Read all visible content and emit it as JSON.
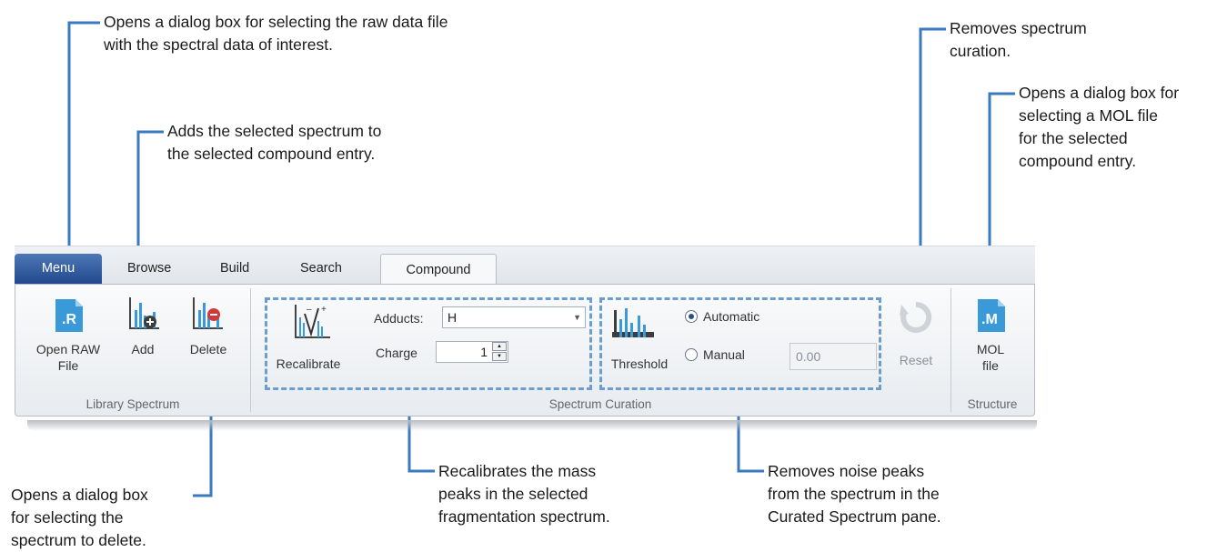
{
  "callouts": {
    "open_raw": [
      "Opens a dialog box for selecting the raw data file",
      "with the spectral data of interest."
    ],
    "add": [
      "Adds the selected spectrum to",
      "the selected compound entry."
    ],
    "reset": [
      "Removes spectrum",
      "curation."
    ],
    "mol": [
      "Opens a dialog box for",
      "selecting a MOL file",
      "for the selected",
      "compound entry."
    ],
    "delete": [
      "Opens a dialog box",
      "for selecting the",
      "spectrum to delete."
    ],
    "recalibrate": [
      "Recalibrates the mass",
      "peaks in the selected",
      "fragmentation spectrum."
    ],
    "threshold": [
      "Removes noise peaks",
      "from the spectrum in the",
      "Curated Spectrum pane."
    ]
  },
  "tabs": [
    "Menu",
    "Browse",
    "Build",
    "Search",
    "Compound"
  ],
  "active_tab": "Compound",
  "groups": {
    "library_spectrum": {
      "label": "Library Spectrum",
      "open_raw": [
        "Open RAW",
        "File"
      ],
      "add": "Add",
      "delete": "Delete"
    },
    "spectrum_curation": {
      "label": "Spectrum Curation",
      "recalibrate": "Recalibrate",
      "adducts_label": "Adducts:",
      "adducts_value": "H",
      "charge_label": "Charge",
      "charge_value": "1",
      "threshold": "Threshold",
      "automatic": "Automatic",
      "manual": "Manual",
      "manual_value": "0.00",
      "automatic_selected": true,
      "reset": "Reset"
    },
    "structure": {
      "label": "Structure",
      "mol": [
        "MOL",
        "file"
      ]
    }
  },
  "icons": {
    "open_raw": "file-r-icon",
    "add": "spectrum-add-icon",
    "delete": "spectrum-delete-icon",
    "recalibrate": "recalibrate-icon",
    "threshold": "threshold-icon",
    "reset": "reset-icon",
    "mol": "file-m-icon"
  },
  "colors": {
    "callout_line": "#3a7bbf",
    "dashed_box": "#6a9ed0",
    "menu_tab": "#2d5aa0",
    "icon_blue": "#3a9ad9"
  }
}
